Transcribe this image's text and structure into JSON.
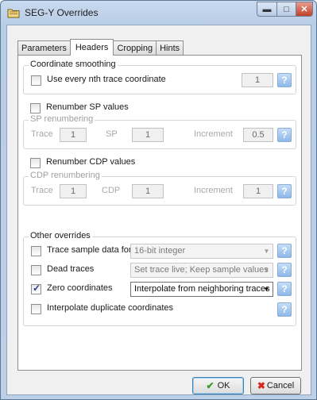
{
  "window": {
    "title": "SEG-Y Overrides",
    "icon": "folder-icon",
    "controls": {
      "minimize": "minimize-icon",
      "maximize": "maximize-icon",
      "close": "close-icon"
    }
  },
  "tabs": [
    {
      "label": "Parameters",
      "active": false
    },
    {
      "label": "Headers",
      "active": true
    },
    {
      "label": "Cropping",
      "active": false
    },
    {
      "label": "Hints",
      "active": false
    }
  ],
  "coordinate_smoothing": {
    "legend": "Coordinate smoothing",
    "checkbox_label": "Use every nth trace coordinate",
    "checked": false,
    "value": "1",
    "help": "?"
  },
  "sp": {
    "checkbox_label": "Renumber SP values",
    "checked": false,
    "legend": "SP renumbering",
    "trace_label": "Trace",
    "trace_value": "1",
    "sp_label": "SP",
    "sp_value": "1",
    "increment_label": "Increment",
    "increment_value": "0.5",
    "help": "?"
  },
  "cdp": {
    "checkbox_label": "Renumber CDP values",
    "checked": false,
    "legend": "CDP renumbering",
    "trace_label": "Trace",
    "trace_value": "1",
    "cdp_label": "CDP",
    "cdp_value": "1",
    "increment_label": "Increment",
    "increment_value": "1",
    "help": "?"
  },
  "other": {
    "legend": "Other overrides",
    "rows": [
      {
        "label": "Trace sample data format",
        "checked": false,
        "combo": "16-bit integer",
        "enabled": false,
        "help": "?"
      },
      {
        "label": "Dead traces",
        "checked": false,
        "combo": "Set trace live;  Keep sample values",
        "enabled": false,
        "help": "?"
      },
      {
        "label": "Zero coordinates",
        "checked": true,
        "combo": "Interpolate from neighboring traces",
        "enabled": true,
        "help": "?"
      },
      {
        "label": "Interpolate duplicate coordinates",
        "checked": false,
        "help": "?"
      }
    ]
  },
  "buttons": {
    "ok": "OK",
    "cancel": "Cancel"
  },
  "colors": {
    "accent": "#8db8ea",
    "ok_check": "#3a9a2a",
    "cancel_x": "#d4281c"
  }
}
